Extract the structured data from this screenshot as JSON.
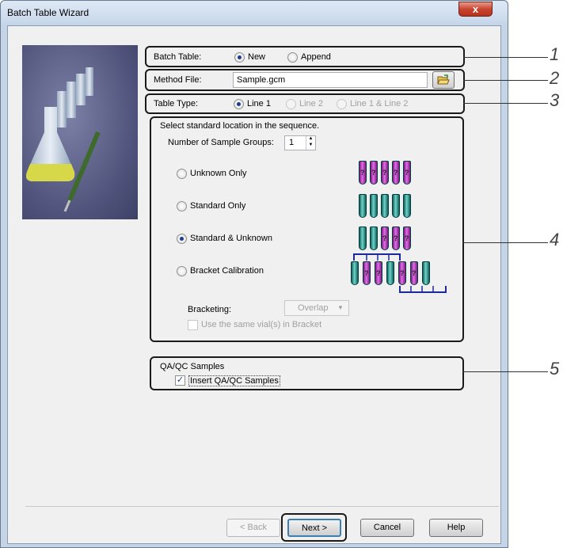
{
  "window": {
    "title": "Batch Table Wizard",
    "close_label": "x"
  },
  "batch_table": {
    "label": "Batch Table:",
    "options": [
      {
        "label": "New",
        "selected": true
      },
      {
        "label": "Append",
        "selected": false
      }
    ]
  },
  "method_file": {
    "label": "Method File:",
    "value": "Sample.gcm",
    "browse_icon": "folder-open-icon"
  },
  "table_type": {
    "label": "Table Type:",
    "options": [
      {
        "label": "Line 1",
        "selected": true,
        "enabled": true
      },
      {
        "label": "Line 2",
        "selected": false,
        "enabled": false
      },
      {
        "label": "Line 1 & Line 2",
        "selected": false,
        "enabled": false
      }
    ]
  },
  "standard_location": {
    "heading": "Select standard location in the sequence.",
    "groups_label": "Number of Sample Groups:",
    "groups_value": "1",
    "options": [
      {
        "label": "Unknown Only",
        "selected": false
      },
      {
        "label": "Standard Only",
        "selected": false
      },
      {
        "label": "Standard & Unknown",
        "selected": true
      },
      {
        "label": "Bracket Calibration",
        "selected": false
      }
    ],
    "bracketing_label": "Bracketing:",
    "bracketing_value": "Overlap",
    "same_vials_label": "Use the same vial(s) in Bracket",
    "same_vials_checked": false
  },
  "qaqc": {
    "heading": "QA/QC Samples",
    "insert_label": "Insert QA/QC Samples",
    "insert_checked": true,
    "check_mark": "✓"
  },
  "buttons": {
    "back": "< Back",
    "next": "Next >",
    "cancel": "Cancel",
    "help": "Help"
  },
  "callouts": [
    "1",
    "2",
    "3",
    "4",
    "5"
  ],
  "vial_marks": {
    "unknown": "?"
  },
  "colors": {
    "standard_vial": "#1a8a83",
    "unknown_vial": "#c44acb",
    "bracket_line": "#1a2a9a"
  }
}
